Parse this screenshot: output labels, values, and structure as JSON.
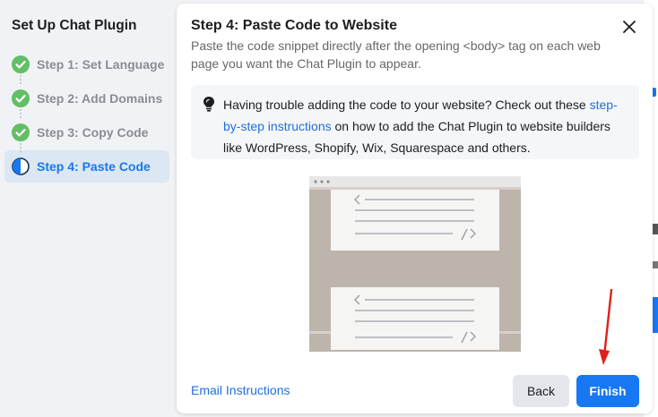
{
  "sidebar": {
    "title": "Set Up Chat Plugin",
    "steps": [
      {
        "label": "Step 1: Set Language",
        "status": "done"
      },
      {
        "label": "Step 2: Add Domains",
        "status": "done"
      },
      {
        "label": "Step 3: Copy Code",
        "status": "done"
      },
      {
        "label": "Step 4: Paste Code",
        "status": "current"
      }
    ]
  },
  "modal": {
    "title": "Step 4: Paste Code to Website",
    "subtitle": "Paste the code snippet directly after the opening <body> tag on each web page you want the Chat Plugin to appear.",
    "tip": {
      "text_before": "Having trouble adding the code to your website? Check out these ",
      "link": "step-by-step instructions",
      "text_after": " on how to add the Chat Plugin to website builders like WordPress, Shopify, Wix, Squarespace and others."
    },
    "email_link": "Email Instructions",
    "back_label": "Back",
    "finish_label": "Finish"
  },
  "colors": {
    "accent": "#1877f2",
    "done_green": "#63be66",
    "link": "#216fdb",
    "annotation_arrow": "#e0201a"
  },
  "icons": {
    "close": "close-icon",
    "tip": "lightbulb-icon",
    "done": "check-circle-icon",
    "current": "half-circle-icon"
  }
}
